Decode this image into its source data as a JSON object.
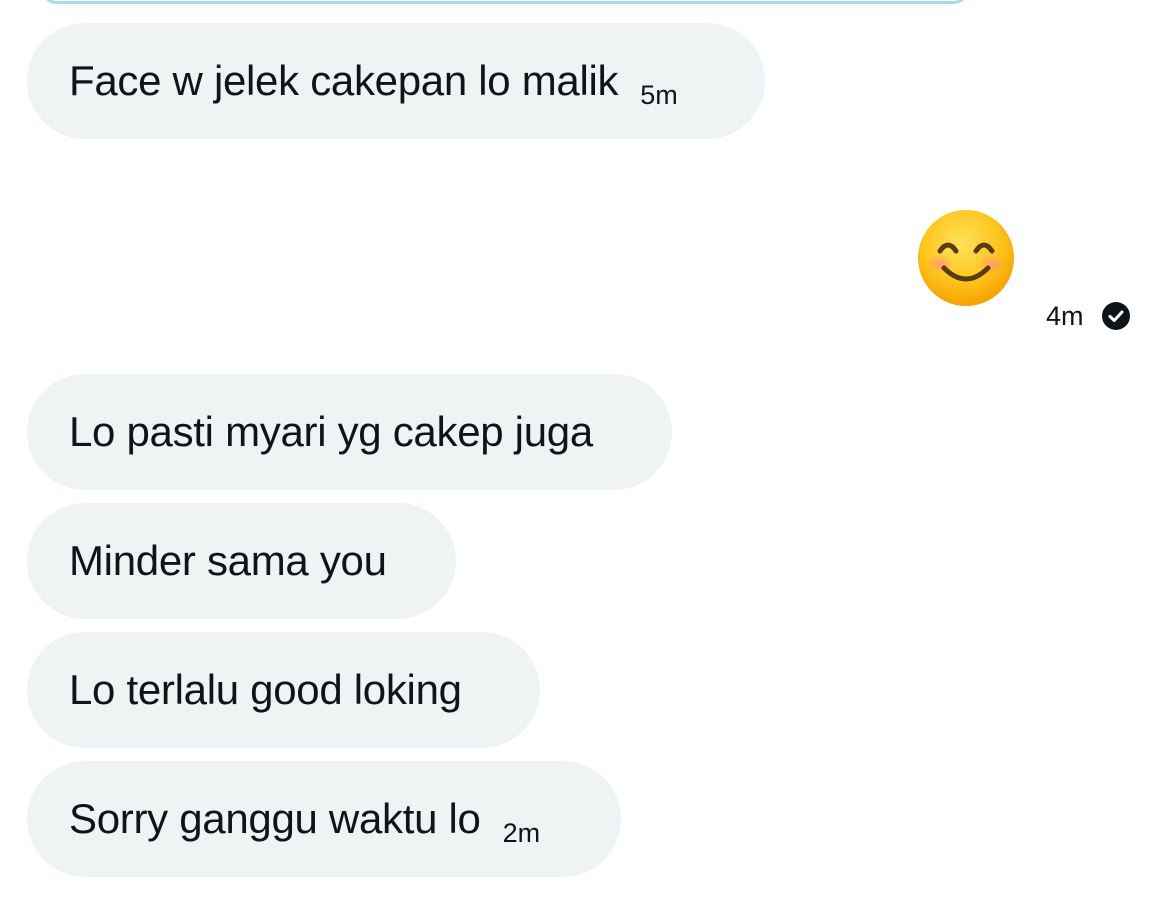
{
  "messages": [
    {
      "text": "Face w jelek cakepan lo malik",
      "time": "5m"
    },
    {
      "emoji": "smiling-face-with-smiling-eyes",
      "time": "4m",
      "status": "seen"
    },
    {
      "text": "Lo pasti myari yg cakep juga"
    },
    {
      "text": "Minder sama you"
    },
    {
      "text": "Lo terlalu good loking"
    },
    {
      "text": "Sorry ganggu waktu lo",
      "time": "2m"
    }
  ],
  "colors": {
    "received_bubble": "#eff3f4",
    "text": "#0f1419",
    "previous_bubble_border": "#a9dbe6",
    "check_badge": "#0f1419"
  }
}
